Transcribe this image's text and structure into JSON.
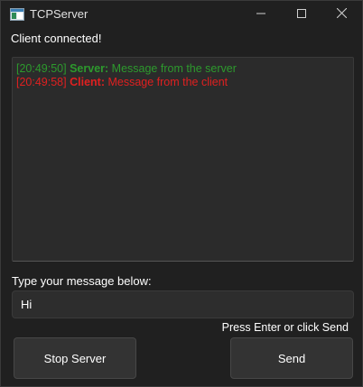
{
  "window": {
    "title": "TCPServer"
  },
  "status": "Client connected!",
  "log": [
    {
      "time": "[20:49:50]",
      "who": "Server:",
      "text": " Message from the server",
      "color": "#2d9a2d"
    },
    {
      "time": "[20:49:58]",
      "who": "Client:",
      "text": " Message from the client",
      "color": "#e02020"
    }
  ],
  "input": {
    "prompt": "Type your message below:",
    "value": "Hi",
    "hint": "Press Enter or click Send"
  },
  "buttons": {
    "stop": "Stop Server",
    "send": "Send"
  },
  "icons": {
    "app": "app-window-icon",
    "minimize": "minimize-icon",
    "maximize": "maximize-icon",
    "close": "close-icon"
  }
}
